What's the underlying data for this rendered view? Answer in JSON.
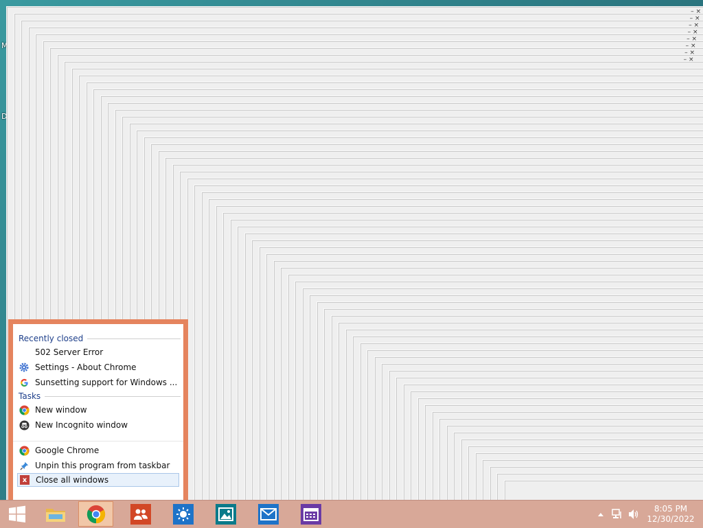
{
  "desktop": {
    "label_m": "M",
    "label_d": "D"
  },
  "jumplist": {
    "recent_header": "Recently closed",
    "recent_items": [
      {
        "label": "502 Server Error",
        "icon": "blank-page-icon"
      },
      {
        "label": "Settings - About Chrome",
        "icon": "gear-icon"
      },
      {
        "label": "Sunsetting support for Windows ...",
        "icon": "google-g-icon"
      }
    ],
    "tasks_header": "Tasks",
    "task_items": [
      {
        "label": "New window",
        "icon": "chrome-icon"
      },
      {
        "label": "New Incognito window",
        "icon": "incognito-icon"
      }
    ],
    "app_item": "Google Chrome",
    "unpin_item": "Unpin this program from taskbar",
    "close_all_item": "Close all windows",
    "accent_color": "#e5845e"
  },
  "taskbar": {
    "color": "#d8a898",
    "apps": [
      "start-button",
      "file-explorer",
      "google-chrome",
      "people",
      "weather",
      "photos",
      "mail",
      "calendar"
    ],
    "clock": {
      "time": "8:05 PM",
      "date": "12/30/2022"
    }
  }
}
